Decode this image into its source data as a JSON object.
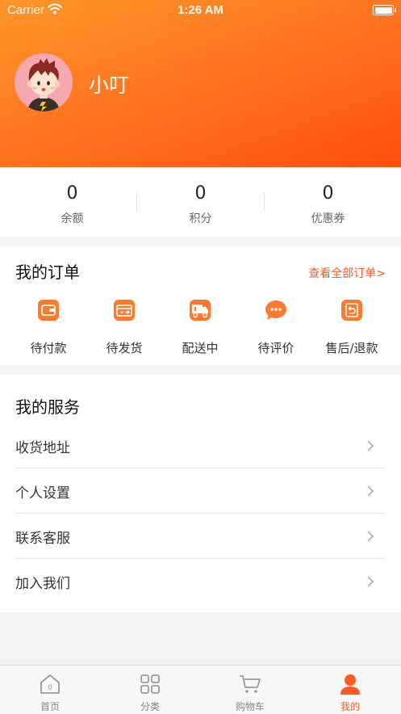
{
  "status_bar": {
    "carrier": "Carrier",
    "time": "1:26 AM"
  },
  "profile": {
    "name": "小叮"
  },
  "stats": [
    {
      "value": "0",
      "label": "余额"
    },
    {
      "value": "0",
      "label": "积分"
    },
    {
      "value": "0",
      "label": "优惠券"
    }
  ],
  "orders": {
    "title": "我的订单",
    "view_all": "查看全部订单>",
    "items": [
      {
        "label": "待付款",
        "icon": "wallet-icon"
      },
      {
        "label": "待发货",
        "icon": "package-icon"
      },
      {
        "label": "配送中",
        "icon": "truck-icon"
      },
      {
        "label": "待评价",
        "icon": "chat-bubble-icon"
      },
      {
        "label": "售后/退款",
        "icon": "return-icon"
      }
    ]
  },
  "services": {
    "title": "我的服务",
    "items": [
      {
        "label": "收货地址"
      },
      {
        "label": "个人设置"
      },
      {
        "label": "联系客服"
      },
      {
        "label": "加入我们"
      }
    ]
  },
  "tabbar": {
    "items": [
      {
        "label": "首页",
        "icon": "home-icon"
      },
      {
        "label": "分类",
        "icon": "grid-icon"
      },
      {
        "label": "购物车",
        "icon": "cart-icon"
      },
      {
        "label": "我的",
        "icon": "user-icon",
        "active": true
      }
    ]
  },
  "colors": {
    "accent": "#ff5a1f",
    "header_start": "#ff9628",
    "header_end": "#ff4f10",
    "icon_inactive": "#9a9a9a"
  }
}
